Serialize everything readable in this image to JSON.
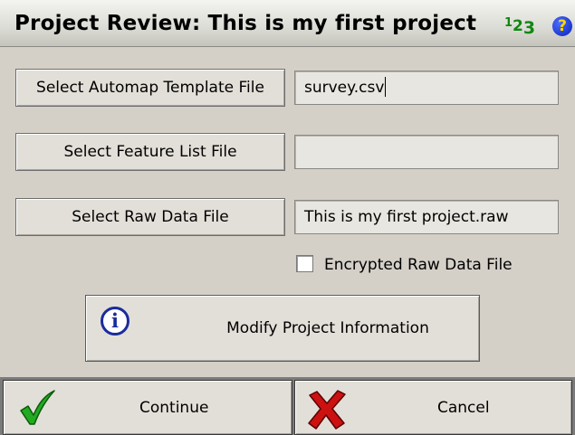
{
  "window": {
    "title": "Project Review: This is my first project",
    "input_mode": {
      "d1": "1",
      "d2": "2",
      "d3": "3"
    },
    "help_icon": "help-icon",
    "help_glyph": "?"
  },
  "files": {
    "automap_button": "Select Automap Template File",
    "automap_value": "survey.csv",
    "feature_button": "Select Feature List File",
    "feature_value": "",
    "rawdata_button": "Select Raw Data File",
    "rawdata_value": "This is my first project.raw"
  },
  "encrypted": {
    "label": "Encrypted Raw Data File",
    "checked": false
  },
  "modify": {
    "label": "Modify Project Information",
    "icon": "info-icon",
    "glyph": "i"
  },
  "actions": {
    "continue": "Continue",
    "continue_icon": "checkmark-icon",
    "cancel": "Cancel",
    "cancel_icon": "x-icon"
  },
  "colors": {
    "background": "#d4d0c8",
    "check_green": "#22aa22",
    "cancel_red": "#cc1111",
    "info_blue": "#1a2c9c"
  }
}
